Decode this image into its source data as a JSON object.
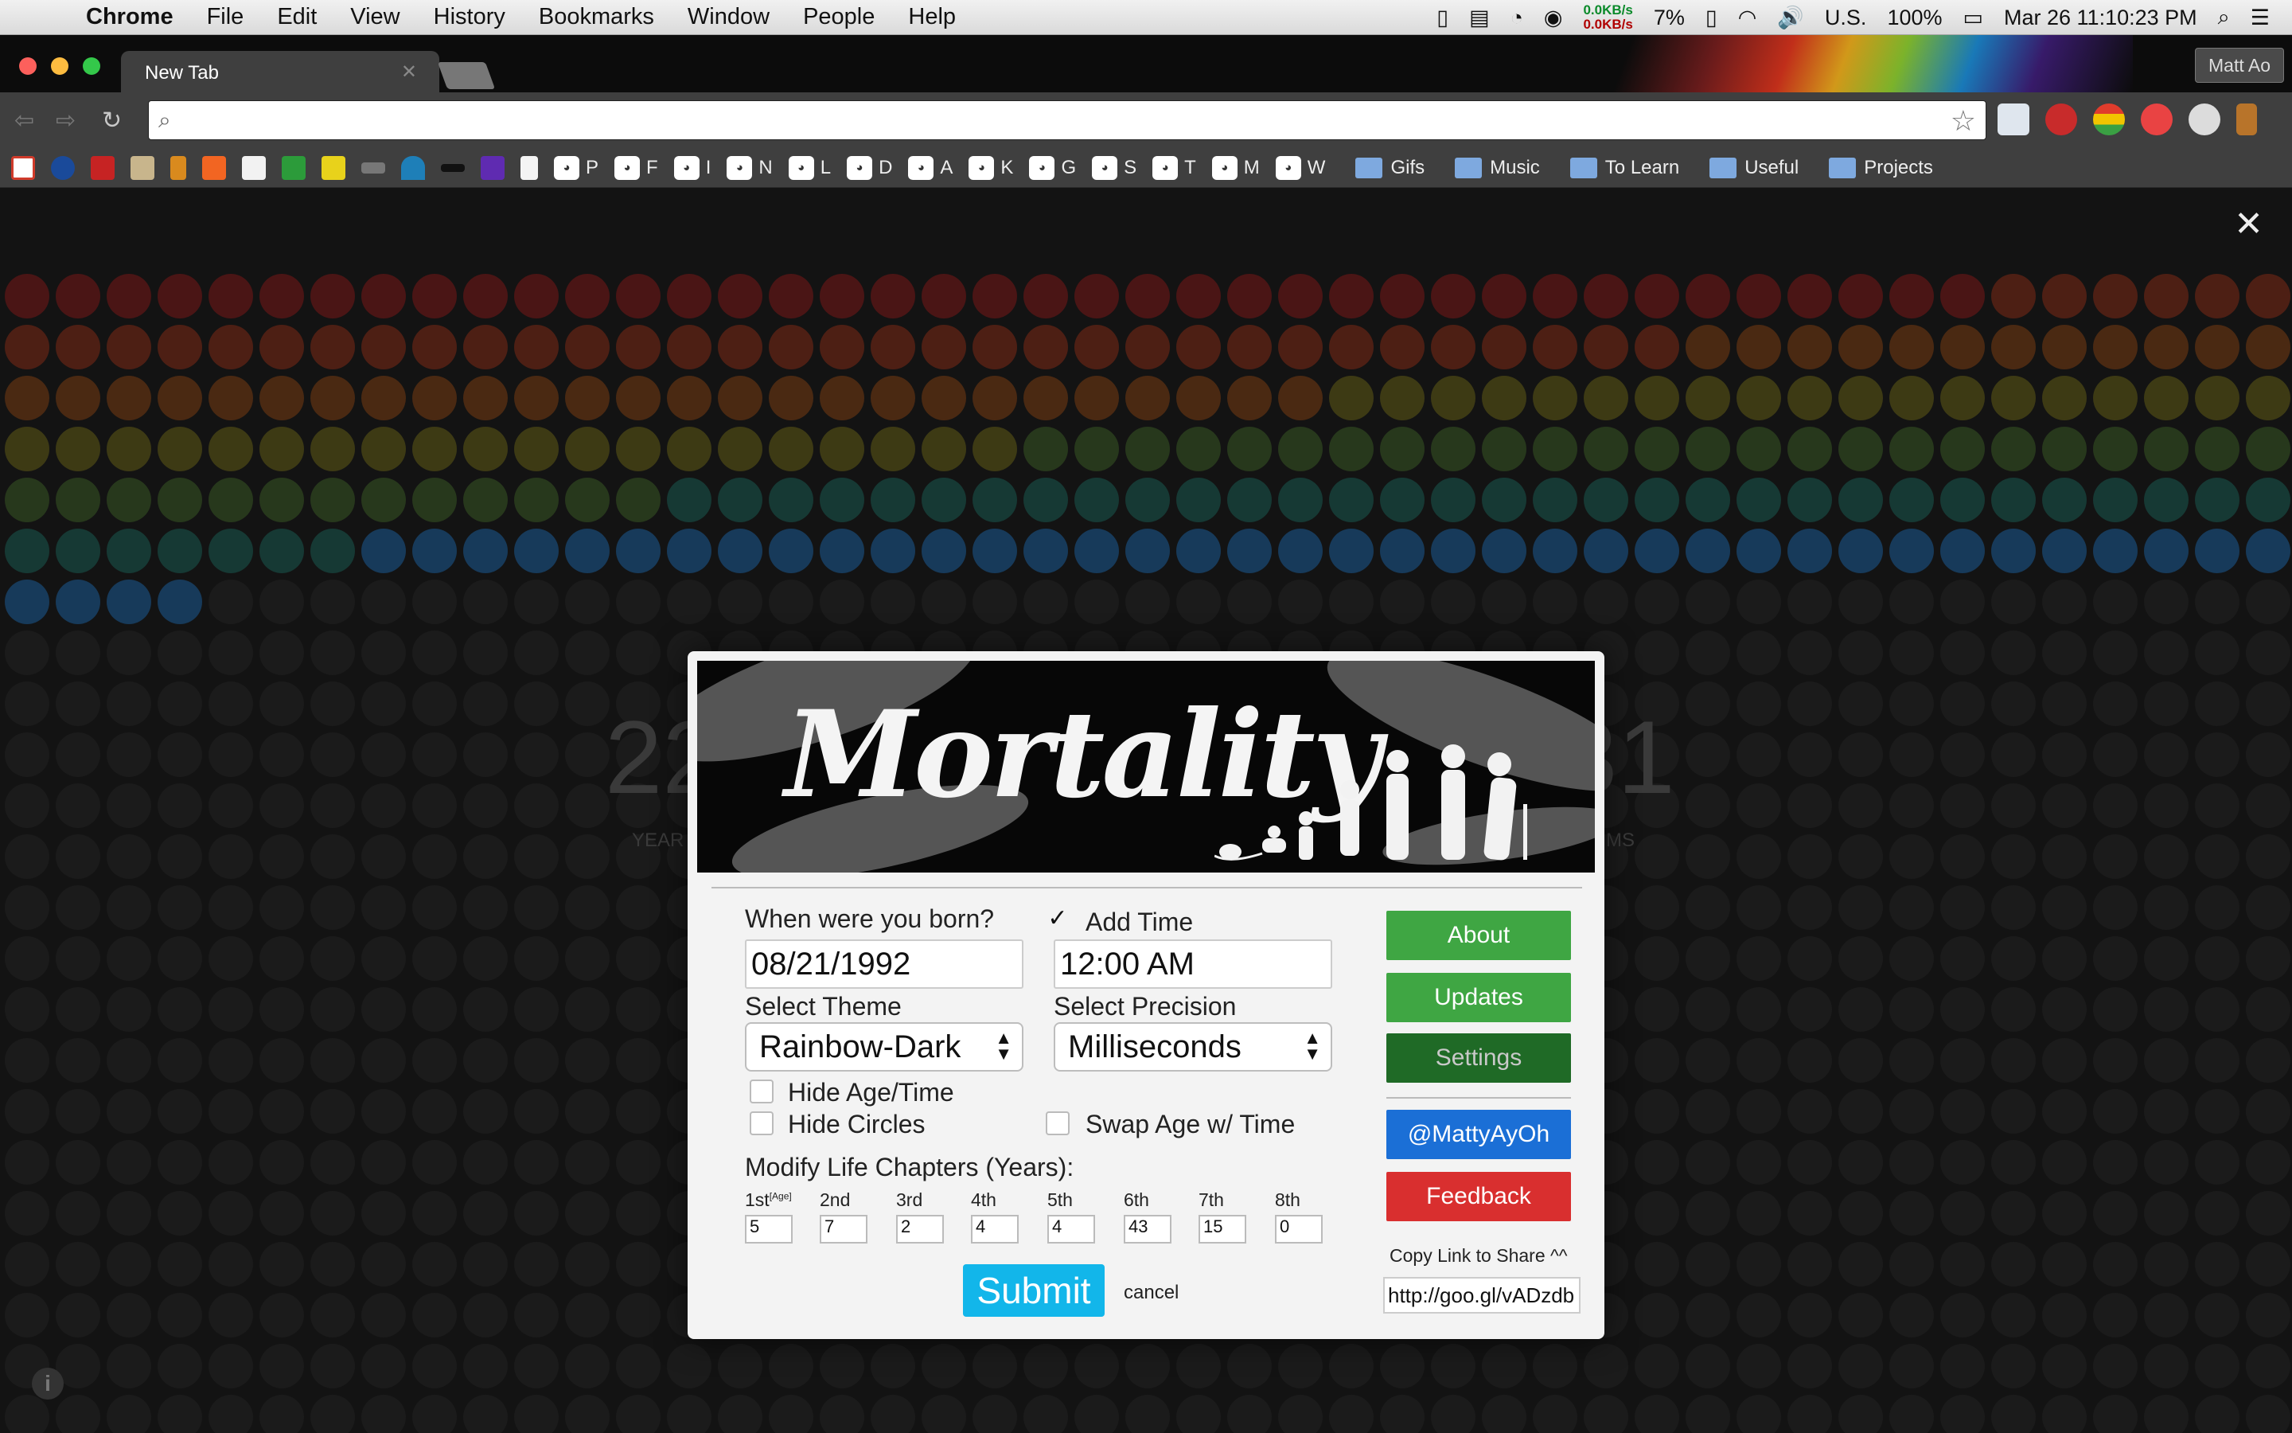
{
  "menubar": {
    "app": "Chrome",
    "items": [
      "File",
      "Edit",
      "View",
      "History",
      "Bookmarks",
      "Window",
      "People",
      "Help"
    ],
    "net_up": "0.0KB/s",
    "net_down": "0.0KB/s",
    "cpu": "7%",
    "input_source": "U.S.",
    "battery": "100%",
    "datetime": "Mar 26  11:10:23 PM"
  },
  "browser": {
    "tab_title": "New Tab",
    "profile": "Matt Ao",
    "url": "",
    "bookmarks": [
      {
        "label": "P"
      },
      {
        "label": "F"
      },
      {
        "label": "I"
      },
      {
        "label": "N"
      },
      {
        "label": "L"
      },
      {
        "label": "D"
      },
      {
        "label": "A"
      },
      {
        "label": "K"
      },
      {
        "label": "G"
      },
      {
        "label": "S"
      },
      {
        "label": "T"
      },
      {
        "label": "M"
      },
      {
        "label": "W"
      }
    ],
    "folders": [
      "Gifs",
      "Music",
      "To Learn",
      "Useful",
      "Projects"
    ],
    "small_icons": [
      "gmail-icon",
      "maps-icon",
      "u-icon",
      "g-icon",
      "stack-icon",
      "y-icon",
      "a1z-icon",
      "td-icon",
      "iwt-icon",
      "hat-icon",
      "magnet-icon",
      "mustache-icon",
      "yahoo-icon",
      "doc-icon"
    ]
  },
  "background": {
    "age_partial_left": "22",
    "age_partial_right": "31",
    "label_left": "YEAR",
    "label_right": "MS",
    "colors": [
      "#4a1515",
      "#4d1f14",
      "#4a2912",
      "#3d3a14",
      "#27381c",
      "#163934",
      "#173a5a"
    ]
  },
  "modal": {
    "banner_title": "Mortality",
    "born_label": "When were you born?",
    "born_value": "08/21/1992",
    "add_time_label": "Add Time",
    "add_time_checked": true,
    "time_value": "12:00 AM",
    "theme_label": "Select Theme",
    "theme_value": "Rainbow-Dark",
    "precision_label": "Select Precision",
    "precision_value": "Milliseconds",
    "hide_age_label": "Hide Age/Time",
    "hide_circles_label": "Hide Circles",
    "swap_label": "Swap Age w/ Time",
    "chapters_label": "Modify Life Chapters (Years):",
    "chapters": [
      {
        "label": "1st",
        "value": "5"
      },
      {
        "label": "2nd",
        "value": "7"
      },
      {
        "label": "3rd",
        "value": "2"
      },
      {
        "label": "4th",
        "value": "4"
      },
      {
        "label": "5th",
        "value": "4"
      },
      {
        "label": "6th",
        "value": "43"
      },
      {
        "label": "7th",
        "value": "15"
      },
      {
        "label": "8th",
        "value": "0"
      }
    ],
    "chapter_first_note": "[Age]",
    "submit": "Submit",
    "cancel": "cancel",
    "buttons": {
      "about": "About",
      "updates": "Updates",
      "settings": "Settings",
      "twitter": "@MattyAyOh",
      "feedback": "Feedback"
    },
    "share_label": "Copy Link to Share ^^",
    "share_url": "http://goo.gl/vADzdb"
  },
  "colors": {
    "about": "#3fa643",
    "updates": "#3fa643",
    "settings": "#1f6a26",
    "twitter": "#1b6fd6",
    "feedback": "#d92f2f",
    "submit": "#12b6ea"
  }
}
